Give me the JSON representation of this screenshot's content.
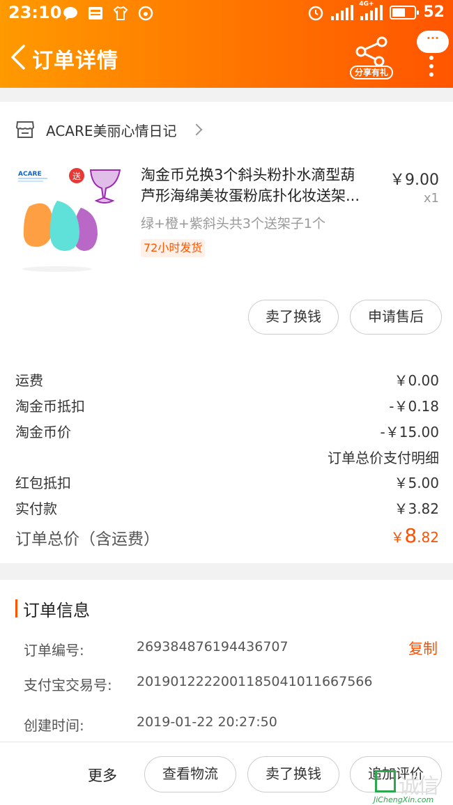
{
  "status_bar": {
    "time": "23:10",
    "battery": "52",
    "network": "4G+"
  },
  "header": {
    "title": "订单详情",
    "share_label": "分享有礼",
    "more_bubble": "···"
  },
  "shop": {
    "name": "ACARE美丽心情日记"
  },
  "product": {
    "title_line1": "淘金币兑换3个斜头粉扑水滴型葫",
    "title_line2": "芦形海绵美妆蛋粉底扑化妆送架...",
    "price": "￥9.00",
    "qty": "x1",
    "sku": "绿+橙+紫斜头共3个送架子1个",
    "tag": "72小时发货",
    "image_brand": "ACARE",
    "image_badge": "送"
  },
  "actions": {
    "sell": "卖了换钱",
    "after_sale": "申请售后"
  },
  "fees": [
    {
      "label": "运费",
      "value": "￥0.00"
    },
    {
      "label": "淘金币抵扣",
      "value": "-￥0.18"
    },
    {
      "label": "淘金币价",
      "value": "-￥15.00"
    }
  ],
  "payment_detail_link": "订单总价支付明细",
  "fees2": [
    {
      "label": "红包抵扣",
      "value": "￥5.00"
    },
    {
      "label": "实付款",
      "value": "￥3.82"
    }
  ],
  "total": {
    "label": "订单总价（含运费）",
    "currency": "￥",
    "int": "8",
    "dec": ".82"
  },
  "order_info": {
    "title": "订单信息",
    "copy_label": "复制",
    "rows": [
      {
        "label": "订单编号:",
        "value": "269384876194436707"
      },
      {
        "label": "支付宝交易号:",
        "value": "2019012222001185041011667566"
      },
      {
        "label": "创建时间:",
        "value": "2019-01-22 20:27:50"
      }
    ]
  },
  "bottom_bar": {
    "more": "更多",
    "logistics": "查看物流",
    "sell": "卖了换钱",
    "review": "追加评价"
  },
  "watermark": {
    "cn": "诚信",
    "en": "JiChengXin.com"
  },
  "colors": {
    "accent": "#ff5500",
    "header_start": "#ff9a00",
    "header_end": "#ff5500"
  }
}
